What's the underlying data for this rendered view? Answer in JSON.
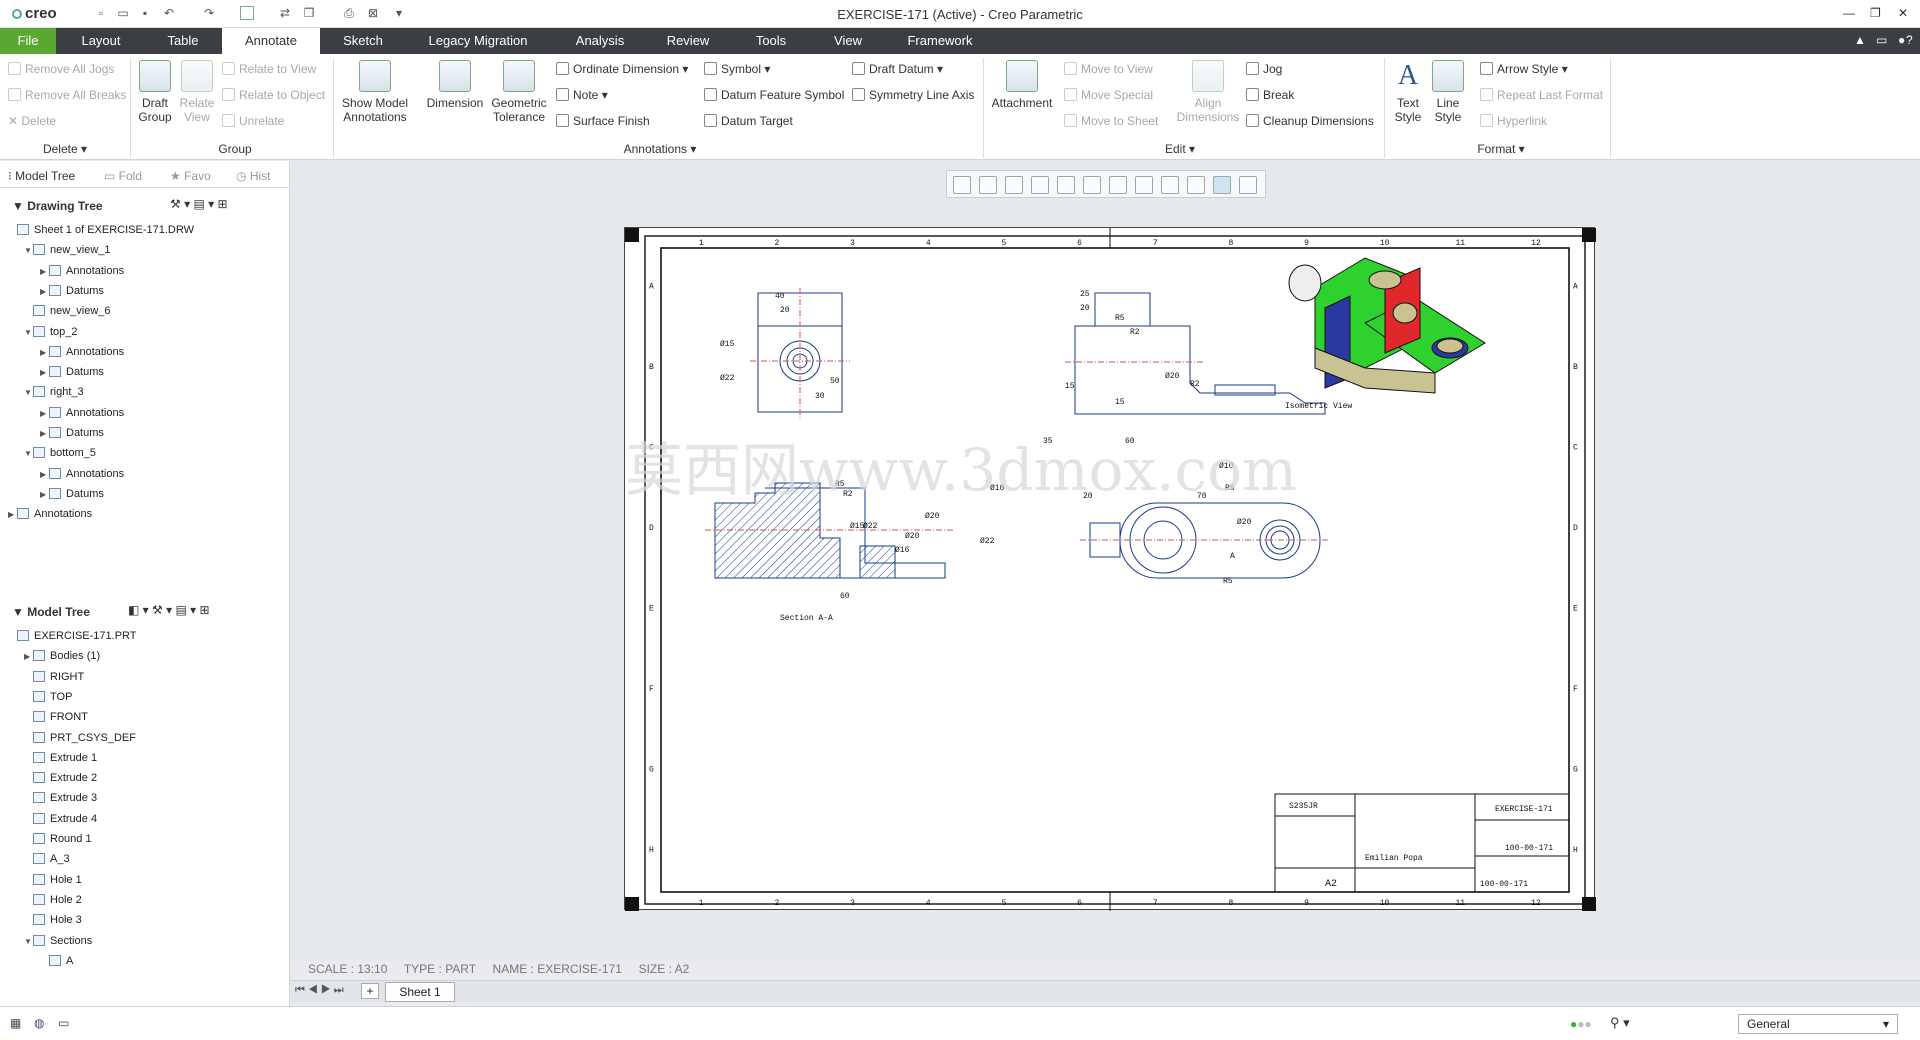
{
  "app": {
    "logo": "creo",
    "window_title": "EXERCISE-171 (Active) - Creo Parametric"
  },
  "tabs": [
    "File",
    "Layout",
    "Table",
    "Annotate",
    "Sketch",
    "Legacy Migration",
    "Analysis",
    "Review",
    "Tools",
    "View",
    "Framework"
  ],
  "active_tab": "Annotate",
  "ribbon": {
    "delete": {
      "remove_all_jogs": "Remove All Jogs",
      "remove_all_breaks": "Remove All Breaks",
      "delete": "Delete",
      "group_label": "Delete"
    },
    "group": {
      "draft_group": "Draft\nGroup",
      "relate_view": "Relate\nView",
      "relate_to_view": "Relate to View",
      "relate_to_object": "Relate to Object",
      "unrelate": "Unrelate",
      "group_label": "Group"
    },
    "annotations": {
      "show_model_annotations": "Show Model\nAnnotations",
      "dimension": "Dimension",
      "geometric_tolerance": "Geometric\nTolerance",
      "ordinate_dimension": "Ordinate Dimension",
      "note": "Note",
      "surface_finish": "Surface Finish",
      "symbol": "Symbol",
      "datum_feature_symbol": "Datum Feature Symbol",
      "datum_target": "Datum Target",
      "draft_datum": "Draft Datum",
      "symmetry_line_axis": "Symmetry Line Axis",
      "group_label": "Annotations"
    },
    "edit": {
      "attachment": "Attachment",
      "move_to_view": "Move to View",
      "move_special": "Move Special",
      "move_to_sheet": "Move to Sheet",
      "align_dimensions": "Align\nDimensions",
      "jog": "Jog",
      "break": "Break",
      "cleanup_dimensions": "Cleanup Dimensions",
      "group_label": "Edit"
    },
    "format": {
      "text_style": "Text\nStyle",
      "line_style": "Line\nStyle",
      "arrow_style": "Arrow Style",
      "repeat_last_format": "Repeat Last Format",
      "hyperlink": "Hyperlink",
      "group_label": "Format"
    }
  },
  "panel_tabs": [
    "Model Tree",
    "Fold",
    "Favo",
    "Hist"
  ],
  "drawing_tree": {
    "header": "Drawing Tree",
    "items": [
      {
        "label": "Sheet 1 of EXERCISE-171.DRW",
        "level": 0,
        "arrow": ""
      },
      {
        "label": "new_view_1",
        "level": 1,
        "arrow": "▼"
      },
      {
        "label": "Annotations",
        "level": 2,
        "arrow": "▶"
      },
      {
        "label": "Datums",
        "level": 2,
        "arrow": "▶"
      },
      {
        "label": "new_view_6",
        "level": 1,
        "arrow": ""
      },
      {
        "label": "top_2",
        "level": 1,
        "arrow": "▼"
      },
      {
        "label": "Annotations",
        "level": 2,
        "arrow": "▶"
      },
      {
        "label": "Datums",
        "level": 2,
        "arrow": "▶"
      },
      {
        "label": "right_3",
        "level": 1,
        "arrow": "▼"
      },
      {
        "label": "Annotations",
        "level": 2,
        "arrow": "▶"
      },
      {
        "label": "Datums",
        "level": 2,
        "arrow": "▶"
      },
      {
        "label": "bottom_5",
        "level": 1,
        "arrow": "▼"
      },
      {
        "label": "Annotations",
        "level": 2,
        "arrow": "▶"
      },
      {
        "label": "Datums",
        "level": 2,
        "arrow": "▶"
      },
      {
        "label": "Annotations",
        "level": 0,
        "arrow": "▶"
      }
    ]
  },
  "model_tree": {
    "header": "Model Tree",
    "items": [
      {
        "label": "EXERCISE-171.PRT",
        "level": 0,
        "arrow": ""
      },
      {
        "label": "Bodies (1)",
        "level": 1,
        "arrow": "▶"
      },
      {
        "label": "RIGHT",
        "level": 1,
        "arrow": ""
      },
      {
        "label": "TOP",
        "level": 1,
        "arrow": ""
      },
      {
        "label": "FRONT",
        "level": 1,
        "arrow": ""
      },
      {
        "label": "PRT_CSYS_DEF",
        "level": 1,
        "arrow": ""
      },
      {
        "label": "Extrude 1",
        "level": 1,
        "arrow": ""
      },
      {
        "label": "Extrude 2",
        "level": 1,
        "arrow": ""
      },
      {
        "label": "Extrude 3",
        "level": 1,
        "arrow": ""
      },
      {
        "label": "Extrude 4",
        "level": 1,
        "arrow": ""
      },
      {
        "label": "Round 1",
        "level": 1,
        "arrow": ""
      },
      {
        "label": "A_3",
        "level": 1,
        "arrow": ""
      },
      {
        "label": "Hole 1",
        "level": 1,
        "arrow": ""
      },
      {
        "label": "Hole 2",
        "level": 1,
        "arrow": ""
      },
      {
        "label": "Hole 3",
        "level": 1,
        "arrow": ""
      },
      {
        "label": "Sections",
        "level": 1,
        "arrow": "▼"
      },
      {
        "label": "A",
        "level": 2,
        "arrow": ""
      }
    ]
  },
  "drawing": {
    "watermark": "莫西网www.3dmox.com",
    "isometric_label": "Isometric View",
    "section_label": "Section A-A",
    "border_cols": [
      "1",
      "2",
      "3",
      "4",
      "5",
      "6",
      "7",
      "8",
      "9",
      "10",
      "11",
      "12"
    ],
    "border_rows": [
      "A",
      "B",
      "C",
      "D",
      "E",
      "F",
      "G",
      "H"
    ],
    "title_block": {
      "material": "S235JR",
      "title": "EXERCISE-171",
      "doc_no": "100-00-171",
      "size": "A2",
      "author": "Emilian Popa"
    },
    "dims": [
      "40",
      "20",
      "50",
      "30",
      "Ø15",
      "Ø22",
      "25",
      "20",
      "R5",
      "R2",
      "15",
      "15",
      "Ø20",
      "R2",
      "35",
      "60",
      "Ø10",
      "R5",
      "R2",
      "Ø15",
      "Ø22",
      "Ø20",
      "Ø16",
      "60",
      "20",
      "R5",
      "70",
      "Ø10",
      "Ø20",
      "Ø22",
      "R5",
      "Ø20",
      "A"
    ],
    "colors": {
      "green": "#2fd12f",
      "red": "#e0282a",
      "blue": "#2a3aa0",
      "tan": "#c9c293"
    }
  },
  "status": {
    "scale": "SCALE : 13:10",
    "type": "TYPE : PART",
    "name": "NAME : EXERCISE-171",
    "size": "SIZE : A2"
  },
  "sheet_tab": "Sheet 1",
  "bottom": {
    "filter": "General"
  }
}
